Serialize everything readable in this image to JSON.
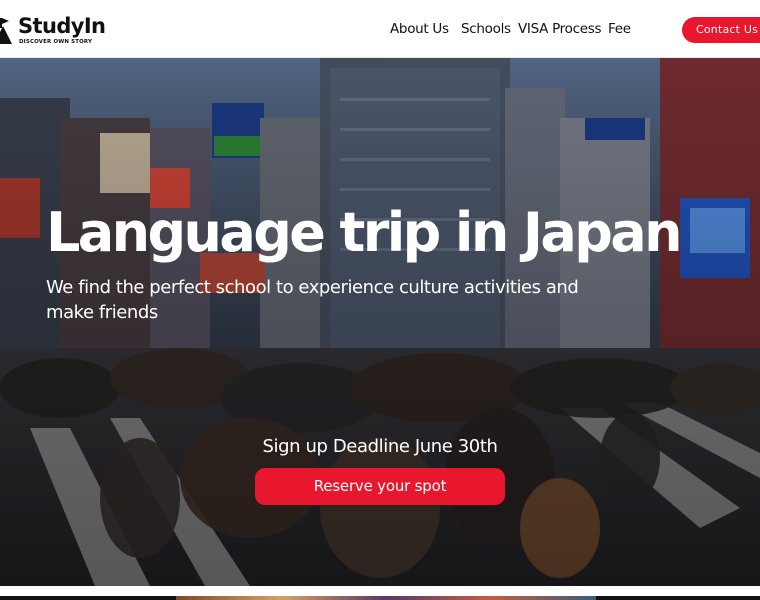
{
  "header": {
    "logo": {
      "name": "StudyIn",
      "tagline": "DISCOVER OWN STORY"
    },
    "nav": [
      {
        "label": "About Us"
      },
      {
        "label": "Schools"
      },
      {
        "label": "VISA Process"
      },
      {
        "label": "Fee"
      }
    ],
    "contact_label": "Contact Us"
  },
  "hero": {
    "title": "Language trip in Japan",
    "subtitle": "We find the perfect school to experience culture activities and make friends",
    "deadline": "Sign up Deadline June 30th",
    "cta_label": "Reserve your spot"
  },
  "colors": {
    "accent": "#e8172d",
    "text_dark": "#111111",
    "hero_overlay": "#1f2630"
  },
  "icons": {
    "logo_mark": "mountain-flag-icon"
  }
}
